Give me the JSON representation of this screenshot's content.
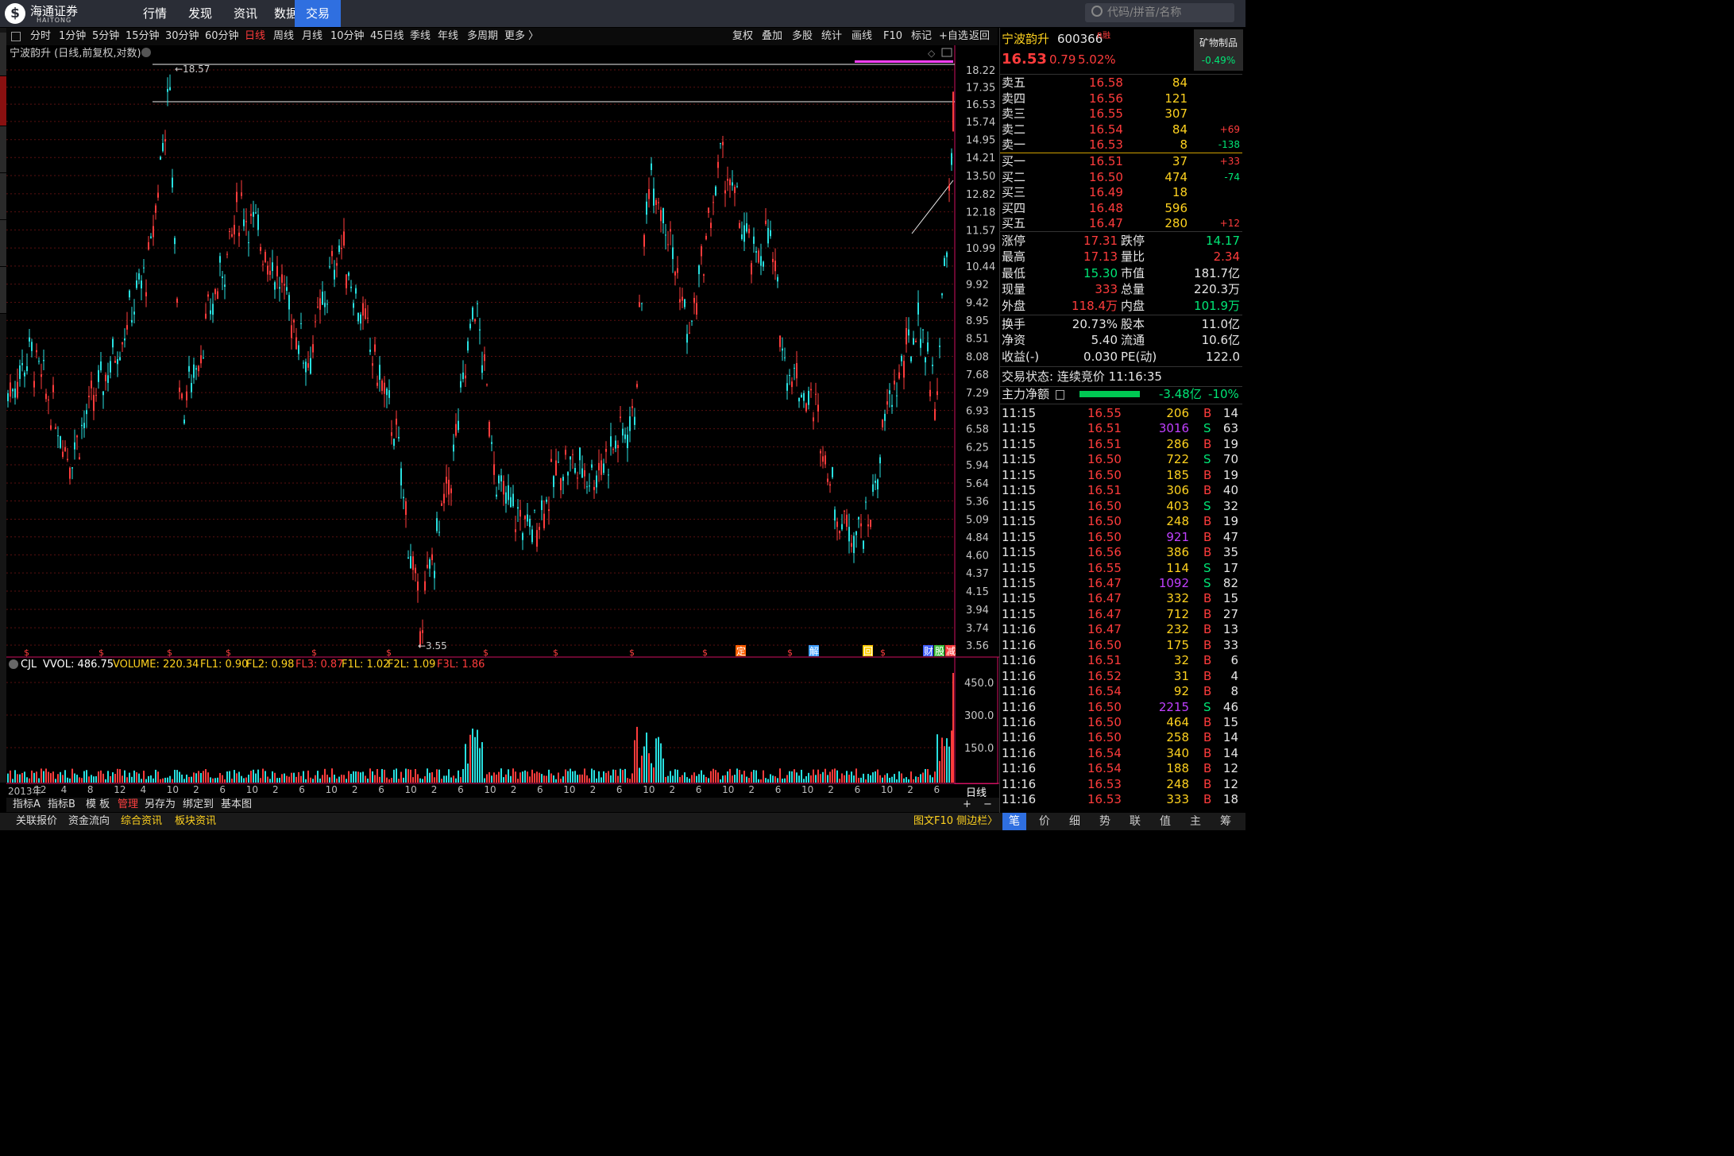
{
  "app": {
    "brand_cn": "海通证券",
    "brand_en": "HAITONG"
  },
  "nav": [
    "行情",
    "发现",
    "资讯",
    "数据",
    "交易"
  ],
  "nav_active": "交易",
  "search": {
    "placeholder": "代码/拼音/名称"
  },
  "periods": [
    "分时",
    "1分钟",
    "5分钟",
    "15分钟",
    "30分钟",
    "60分钟",
    "日线",
    "周线",
    "月线",
    "10分钟",
    "45日线",
    "季线",
    "年线",
    "多周期",
    "更多 〉"
  ],
  "period_selected": "日线",
  "tools": [
    "复权",
    "叠加",
    "多股",
    "统计",
    "画线",
    "F10",
    "标记",
    "+自选",
    "返回"
  ],
  "chart": {
    "title": "宁波韵升 (日线,前复权,对数)",
    "price_ticks": [
      "18.22",
      "17.35",
      "16.53",
      "15.74",
      "14.95",
      "14.21",
      "13.50",
      "12.82",
      "12.18",
      "11.57",
      "10.99",
      "10.44",
      "9.92",
      "9.42",
      "8.95",
      "8.51",
      "8.08",
      "7.68",
      "7.29",
      "6.93",
      "6.58",
      "6.25",
      "5.94",
      "5.64",
      "5.36",
      "5.09",
      "4.84",
      "4.60",
      "4.37",
      "4.15",
      "3.94",
      "3.74",
      "3.56"
    ],
    "high_label": "18.57",
    "low_label": "3.55",
    "event_markers": [
      "定",
      "解",
      "回",
      "财",
      "股",
      "减"
    ],
    "indicator_label": {
      "name": "CJL",
      "vvol": "VVOL: 486.75",
      "volume": "VOLUME: 220.34",
      "fl1": "FL1: 0.90",
      "fl2": "FL2: 0.98",
      "fl3": "FL3: 0.87",
      "f1l": "F1L: 1.02",
      "f2l": "F2L: 1.09",
      "f3l": "F3L: 1.86"
    },
    "vol_ticks": [
      "450.0",
      "300.0",
      "150.0"
    ],
    "x_labels": [
      "2013年",
      "12",
      "4",
      "8",
      "12",
      "4",
      "10",
      "2",
      "6",
      "10",
      "2",
      "6",
      "10",
      "2",
      "6",
      "10",
      "2",
      "6",
      "10",
      "2",
      "6",
      "10",
      "2",
      "6",
      "10",
      "2",
      "6",
      "10",
      "2",
      "6",
      "10",
      "2",
      "6",
      "10",
      "2",
      "6"
    ],
    "period_tag": "日线",
    "colors": {
      "up": "#ff3c3c",
      "down": "#28e0e0",
      "grid": "#5a1010",
      "axis": "#c8c8c8"
    }
  },
  "bottom_bar1": [
    "指标A",
    "指标B",
    "模 板",
    "管理",
    "另存为",
    "绑定到",
    "基本图"
  ],
  "bottom_bar2": [
    "关联报价",
    "资金流向",
    "综合资讯",
    "板块资讯"
  ],
  "bottom_right": "图文F10 侧边栏〉",
  "quote": {
    "name": "宁波韵升",
    "code": "600366",
    "flag": "R",
    "tag": "融",
    "price": "16.53",
    "change": "0.79",
    "pct": "5.02%",
    "sector": "矿物制品",
    "sector_pct": "-0.49%",
    "asks": [
      {
        "label": "卖五",
        "price": "16.58",
        "vol": "84",
        "delta": ""
      },
      {
        "label": "卖四",
        "price": "16.56",
        "vol": "121",
        "delta": ""
      },
      {
        "label": "卖三",
        "price": "16.55",
        "vol": "307",
        "delta": ""
      },
      {
        "label": "卖二",
        "price": "16.54",
        "vol": "84",
        "delta": "+69"
      },
      {
        "label": "卖一",
        "price": "16.53",
        "vol": "8",
        "delta": "-138"
      }
    ],
    "bids": [
      {
        "label": "买一",
        "price": "16.51",
        "vol": "37",
        "delta": "+33"
      },
      {
        "label": "买二",
        "price": "16.50",
        "vol": "474",
        "delta": "-74"
      },
      {
        "label": "买三",
        "price": "16.49",
        "vol": "18",
        "delta": ""
      },
      {
        "label": "买四",
        "price": "16.48",
        "vol": "596",
        "delta": ""
      },
      {
        "label": "买五",
        "price": "16.47",
        "vol": "280",
        "delta": "+12"
      }
    ],
    "stats1": [
      {
        "l1": "涨停",
        "v1": "17.31",
        "l2": "跌停",
        "v2": "14.17"
      },
      {
        "l1": "最高",
        "v1": "17.13",
        "l2": "量比",
        "v2": "2.34"
      },
      {
        "l1": "最低",
        "v1": "15.30",
        "l2": "市值",
        "v2": "181.7亿"
      },
      {
        "l1": "现量",
        "v1": "333",
        "l2": "总量",
        "v2": "220.3万"
      },
      {
        "l1": "外盘",
        "v1": "118.4万",
        "l2": "内盘",
        "v2": "101.9万"
      }
    ],
    "stats2": [
      {
        "l1": "换手",
        "v1": "20.73%",
        "l2": "股本",
        "v2": "11.0亿"
      },
      {
        "l1": "净资",
        "v1": "5.40",
        "l2": "流通",
        "v2": "10.6亿"
      },
      {
        "l1": "收益(-)",
        "v1": "0.030",
        "l2": "PE(动)",
        "v2": "122.0"
      }
    ],
    "trade_status": "交易状态: 连续竞价 11:16:35",
    "main_flow_label": "主力净额",
    "main_flow_value": "-3.48亿",
    "main_flow_pct": "-10%"
  },
  "ticks": [
    {
      "t": "11:15",
      "p": "16.55",
      "v": "206",
      "s": "B",
      "n": "14"
    },
    {
      "t": "11:15",
      "p": "16.51",
      "v": "3016",
      "s": "S",
      "n": "63"
    },
    {
      "t": "11:15",
      "p": "16.51",
      "v": "286",
      "s": "B",
      "n": "19"
    },
    {
      "t": "11:15",
      "p": "16.50",
      "v": "722",
      "s": "S",
      "n": "70"
    },
    {
      "t": "11:15",
      "p": "16.50",
      "v": "185",
      "s": "B",
      "n": "19"
    },
    {
      "t": "11:15",
      "p": "16.51",
      "v": "306",
      "s": "B",
      "n": "40"
    },
    {
      "t": "11:15",
      "p": "16.50",
      "v": "403",
      "s": "S",
      "n": "32"
    },
    {
      "t": "11:15",
      "p": "16.50",
      "v": "248",
      "s": "B",
      "n": "19"
    },
    {
      "t": "11:15",
      "p": "16.50",
      "v": "921",
      "s": "B",
      "n": "47"
    },
    {
      "t": "11:15",
      "p": "16.56",
      "v": "386",
      "s": "B",
      "n": "35"
    },
    {
      "t": "11:15",
      "p": "16.55",
      "v": "114",
      "s": "S",
      "n": "17"
    },
    {
      "t": "11:15",
      "p": "16.47",
      "v": "1092",
      "s": "S",
      "n": "82"
    },
    {
      "t": "11:15",
      "p": "16.47",
      "v": "332",
      "s": "B",
      "n": "15"
    },
    {
      "t": "11:15",
      "p": "16.47",
      "v": "712",
      "s": "B",
      "n": "27"
    },
    {
      "t": "11:16",
      "p": "16.47",
      "v": "232",
      "s": "B",
      "n": "13"
    },
    {
      "t": "11:16",
      "p": "16.50",
      "v": "175",
      "s": "B",
      "n": "33"
    },
    {
      "t": "11:16",
      "p": "16.51",
      "v": "32",
      "s": "B",
      "n": "6"
    },
    {
      "t": "11:16",
      "p": "16.52",
      "v": "31",
      "s": "B",
      "n": "4"
    },
    {
      "t": "11:16",
      "p": "16.54",
      "v": "92",
      "s": "B",
      "n": "8"
    },
    {
      "t": "11:16",
      "p": "16.50",
      "v": "2215",
      "s": "S",
      "n": "46"
    },
    {
      "t": "11:16",
      "p": "16.50",
      "v": "464",
      "s": "B",
      "n": "15"
    },
    {
      "t": "11:16",
      "p": "16.50",
      "v": "258",
      "s": "B",
      "n": "14"
    },
    {
      "t": "11:16",
      "p": "16.54",
      "v": "340",
      "s": "B",
      "n": "14"
    },
    {
      "t": "11:16",
      "p": "16.54",
      "v": "188",
      "s": "B",
      "n": "12"
    },
    {
      "t": "11:16",
      "p": "16.53",
      "v": "248",
      "s": "B",
      "n": "12"
    },
    {
      "t": "11:16",
      "p": "16.53",
      "v": "333",
      "s": "B",
      "n": "18"
    }
  ],
  "bottom_tabs": [
    "笔",
    "价",
    "细",
    "势",
    "联",
    "值",
    "主",
    "筹"
  ],
  "bottom_tab_selected": "笔"
}
